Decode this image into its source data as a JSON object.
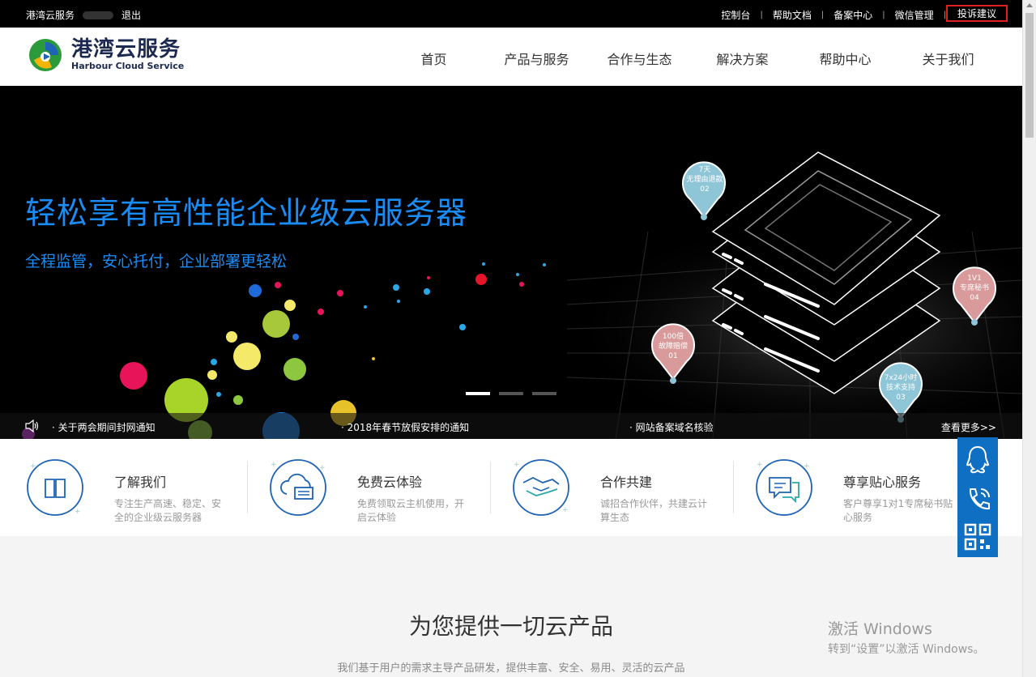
{
  "topbar": {
    "brand": "港湾云服务",
    "logout": "退出",
    "links": [
      "控制台",
      "帮助文档",
      "备案中心",
      "微信管理"
    ],
    "highlight_link": "投诉建议",
    "separator": "|"
  },
  "header": {
    "logo_cn": "港湾云服务",
    "logo_en": "Harbour Cloud Service",
    "nav": [
      "首页",
      "产品与服务",
      "合作与生态",
      "解决方案",
      "帮助中心",
      "关于我们"
    ]
  },
  "banner": {
    "title": "轻松享有高性能企业级云服务器",
    "subtitle": "全程监管，安心托付，企业部署更轻松",
    "active_slide": 1,
    "slide_count": 3,
    "pins": [
      {
        "line1": "7天",
        "line2": "无理由退款",
        "num": "02"
      },
      {
        "line1": "1V1",
        "line2": "专席秘书",
        "num": "04"
      },
      {
        "line1": "100倍",
        "line2": "故障赔偿",
        "num": "01"
      },
      {
        "line1": "7x24小时",
        "line2": "技术支持",
        "num": "03"
      }
    ]
  },
  "notices": {
    "items": [
      "关于两会期间封网通知",
      "2018年春节放假安排的通知",
      "网站备案域名核验"
    ],
    "more": "查看更多>>"
  },
  "features": [
    {
      "title": "了解我们",
      "desc": "专注生产高速、稳定、安全的企业级云服务器",
      "icon": "book-icon"
    },
    {
      "title": "免费云体验",
      "desc": "免费领取云主机使用，开启云体验",
      "icon": "cloud-server-icon"
    },
    {
      "title": "合作共建",
      "desc": "诚招合作伙伴，共建云计算生态",
      "icon": "handshake-icon"
    },
    {
      "title": "尊享贴心服务",
      "desc": "客户尊享1对1专席秘书贴心服务",
      "icon": "chat-icon"
    }
  ],
  "section": {
    "title": "为您提供一切云产品",
    "desc": "我们基于用户的需求主导产品研发，提供丰富、安全、易用、灵活的云产品"
  },
  "watermark": {
    "line1": "激活 Windows",
    "line2": "转到“设置”以激活 Windows。"
  },
  "colors": {
    "accent": "#1a8cf5",
    "side_panel": "#0f6fc2",
    "highlight_border": "#e02020"
  }
}
